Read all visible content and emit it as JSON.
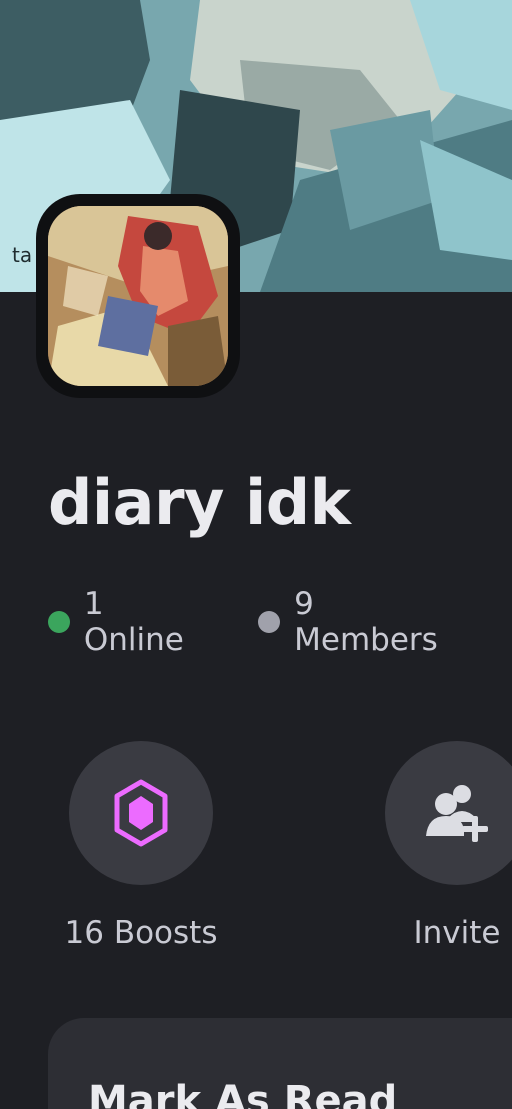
{
  "server": {
    "name": "diary idk"
  },
  "stats": {
    "online_label": "1 Online",
    "online_color": "#3ba55d",
    "members_label": "9 Members",
    "members_color": "#a0a1ab"
  },
  "actions": {
    "boosts": {
      "label": "16 Boosts",
      "icon": "boost-gem-icon",
      "icon_color": "#ec6bff"
    },
    "invite": {
      "label": "Invite",
      "icon": "add-member-icon"
    }
  },
  "menu": {
    "first_item": "Mark As Read"
  },
  "banner": {
    "text_fragment": "ta"
  }
}
